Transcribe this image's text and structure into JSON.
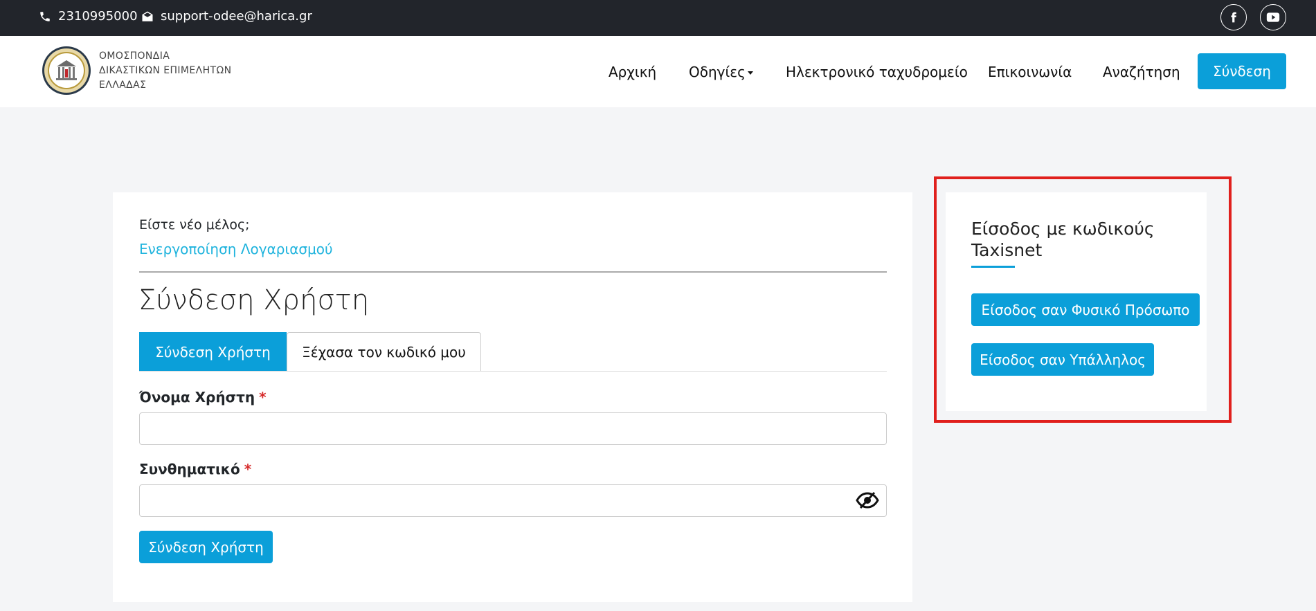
{
  "topbar": {
    "phone": "2310995000",
    "email": "support-odee@harica.gr",
    "social": [
      "facebook-icon",
      "youtube-icon"
    ]
  },
  "header": {
    "brand_lines": [
      "ΟΜΟΣΠΟΝΔΙΑ",
      "ΔΙΚΑΣΤΙΚΩΝ ΕΠΙΜΕΛΗΤΩΝ",
      "ΕΛΛΑΔΑΣ"
    ],
    "nav": {
      "home": "Αρχική",
      "guides": "Οδηγίες",
      "email": "Ηλεκτρονικό ταχυδρομείο",
      "contact": "Επικοινωνία",
      "search": "Αναζήτηση"
    },
    "login_button": "Σύνδεση"
  },
  "login": {
    "new_member": "Είστε νέο μέλος;",
    "activate_link": "Ενεργοποίηση Λογαριασμού",
    "title": "Σύνδεση Χρήστη",
    "tabs": [
      "Σύνδεση Χρήστη",
      "Ξέχασα τον κωδικό μου"
    ],
    "username_label": "Όνομα Χρήστη",
    "password_label": "Συνθηματικό",
    "required_mark": "*",
    "username_value": "",
    "password_value": "",
    "submit": "Σύνδεση Χρήστη"
  },
  "taxisnet": {
    "title": "Είσοδος με κωδικούς Taxisnet",
    "btn_person": "Είσοδος σαν Φυσικό Πρόσωπο",
    "btn_employee": "Είσοδος σαν Υπάλληλος"
  },
  "colors": {
    "accent": "#0b9fd9",
    "link": "#1eb3dd",
    "topbar": "#22252b",
    "highlight": "#e0201d",
    "required": "#d62b2b"
  }
}
